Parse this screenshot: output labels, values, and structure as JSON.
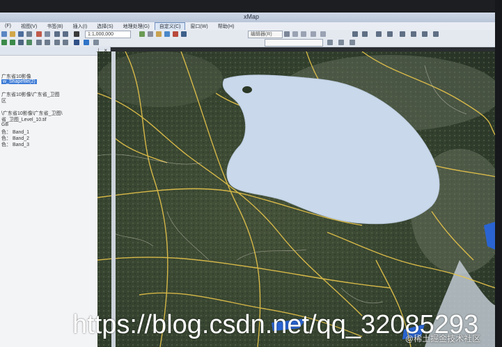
{
  "window": {
    "title": "xMap"
  },
  "menu": [
    {
      "label": "(F)"
    },
    {
      "label": "视图(V)"
    },
    {
      "label": "书签(B)"
    },
    {
      "label": "插入(I)"
    },
    {
      "label": "选择(S)"
    },
    {
      "label": "地理处理(G)"
    },
    {
      "label": "自定义(C)",
      "active": true
    },
    {
      "label": "窗口(W)"
    },
    {
      "label": "帮助(H)"
    }
  ],
  "toolbar": {
    "scale": "1:1,000,000",
    "editor_label": "编辑器(R)"
  },
  "toc": {
    "lines": [
      {
        "text": "广东省10影像",
        "selected": false
      },
      {
        "text": "w_Shapefile(2)",
        "selected": true
      },
      {
        "text": "广东省10影像\\广东省_卫图",
        "selected": false
      },
      {
        "text": "区",
        "selected": false
      },
      {
        "text": "\\广东省10影像\\广东省_卫图\\",
        "selected": false
      },
      {
        "text": "省_卫图_Level_10.tif",
        "selected": false
      },
      {
        "text": "GB",
        "selected": false
      },
      {
        "text": "色：  Band_1",
        "selected": false
      },
      {
        "text": "色：  Band_2",
        "selected": false
      },
      {
        "text": "色：  Band_3",
        "selected": false
      }
    ]
  },
  "overlay": {
    "url_text": "https://blog.csdn.net/qq_32085293",
    "credit": "@稀土掘金技术社区"
  },
  "colors": {
    "polygon_fill": "#c9d8ea",
    "road": "#e7c44a",
    "terrain_dark": "#2c3827",
    "water": "#2a64d2"
  }
}
